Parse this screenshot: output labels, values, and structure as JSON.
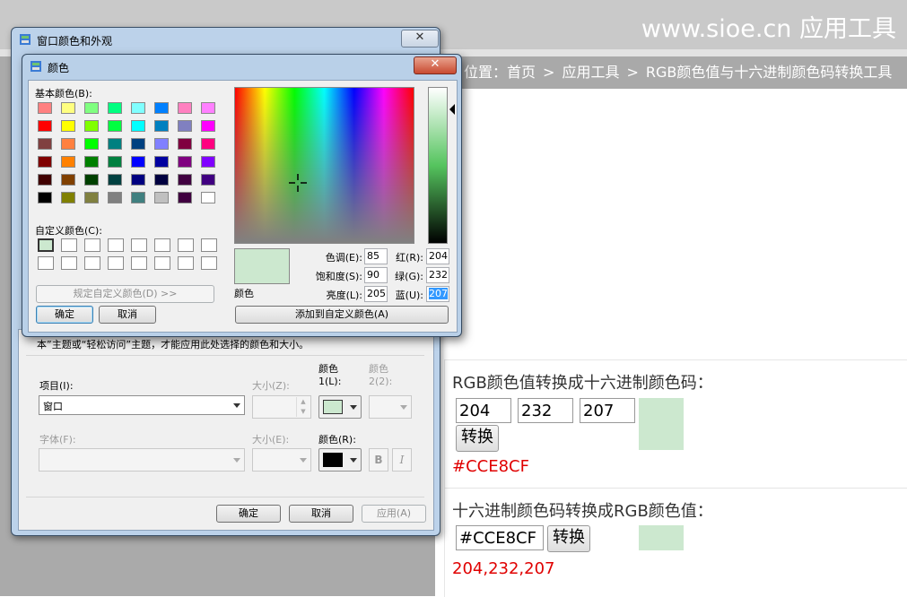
{
  "site": {
    "logo": "www.sioe.cn 应用工具",
    "breadcrumb": {
      "prefix": "位置：",
      "home": "首页",
      "sep": ">",
      "section": "应用工具",
      "page": "RGB颜色值与十六进制颜色码转换工具"
    },
    "rgb_to_hex": {
      "title": "RGB颜色值转换成十六进制颜色码：",
      "r": "204",
      "g": "232",
      "b": "207",
      "button": "转换",
      "result": "#CCE8CF",
      "preview_color": "#cce8cf"
    },
    "hex_to_rgb": {
      "title": "十六进制颜色码转换成RGB颜色值：",
      "hex": "#CCE8CF",
      "button": "转换",
      "result": "204,232,207",
      "preview_color": "#cce8cf"
    }
  },
  "appearance_window": {
    "title": "窗口颜色和外观",
    "close": "✕",
    "note": "本”主题或“轻松访问”主题，才能应用此处选择的颜色和大小。",
    "item_label": "项目(I):",
    "item_value": "窗口",
    "size_label": "大小(Z):",
    "color1_label_a": "颜色",
    "color1_label_b": "1(L):",
    "color2_label_a": "颜色",
    "color2_label_b": "2(2):",
    "font_label": "字体(F):",
    "font_size_label": "大小(E):",
    "font_color_label": "颜色(R):",
    "bold": "B",
    "italic": "I",
    "color1_value": "#cce8cf",
    "font_color_value": "#000000",
    "ok": "确定",
    "cancel": "取消",
    "apply": "应用(A)"
  },
  "color_dialog": {
    "title": "颜色",
    "close": "✕",
    "basic_colors_label": "基本颜色(B):",
    "custom_colors_label": "自定义颜色(C):",
    "define_custom": "规定自定义颜色(D) >>",
    "ok": "确定",
    "cancel": "取消",
    "color_solid_label": "颜色",
    "hue_label": "色调(E):",
    "hue": "85",
    "sat_label": "饱和度(S):",
    "sat": "90",
    "lum_label": "亮度(L):",
    "lum": "205",
    "red_label": "红(R):",
    "red": "204",
    "green_label": "绿(G):",
    "green": "232",
    "blue_label": "蓝(U):",
    "blue": "207",
    "add_custom": "添加到自定义颜色(A)",
    "current_color": "#cce8cf",
    "basic_colors": [
      "#ff8080",
      "#ffff80",
      "#80ff80",
      "#00ff80",
      "#80ffff",
      "#0080ff",
      "#ff80c0",
      "#ff80ff",
      "#ff0000",
      "#ffff00",
      "#80ff00",
      "#00ff40",
      "#00ffff",
      "#0080c0",
      "#8080c0",
      "#ff00ff",
      "#804040",
      "#ff8040",
      "#00ff00",
      "#008080",
      "#004080",
      "#8080ff",
      "#800040",
      "#ff0080",
      "#800000",
      "#ff8000",
      "#008000",
      "#008040",
      "#0000ff",
      "#0000a0",
      "#800080",
      "#8000ff",
      "#400000",
      "#804000",
      "#004000",
      "#004040",
      "#000080",
      "#000040",
      "#400040",
      "#400080",
      "#000000",
      "#808000",
      "#808040",
      "#808080",
      "#408080",
      "#c0c0c0",
      "#400040",
      "#ffffff"
    ],
    "custom_colors": [
      "#cce8cf",
      "#ffffff",
      "#ffffff",
      "#ffffff",
      "#ffffff",
      "#ffffff",
      "#ffffff",
      "#ffffff",
      "#ffffff",
      "#ffffff",
      "#ffffff",
      "#ffffff",
      "#ffffff",
      "#ffffff",
      "#ffffff",
      "#ffffff"
    ]
  }
}
